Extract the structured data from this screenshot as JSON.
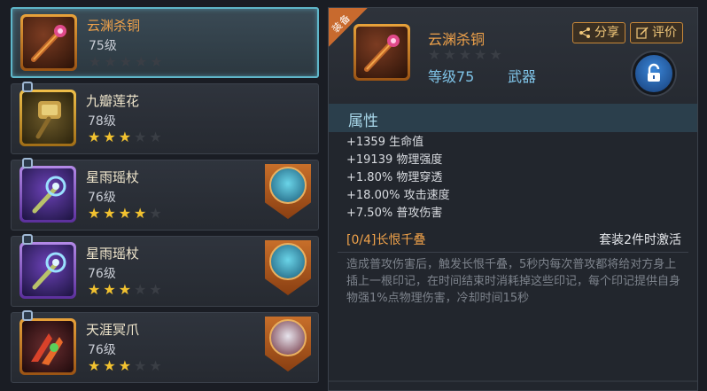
{
  "items": [
    {
      "name": "云渊杀铜",
      "level": "75级",
      "stars": 0,
      "selected": true,
      "locked": false,
      "badge": false
    },
    {
      "name": "九瓣莲花",
      "level": "78级",
      "stars": 3,
      "selected": false,
      "locked": true,
      "badge": false
    },
    {
      "name": "星雨瑶杖",
      "level": "76级",
      "stars": 4,
      "selected": false,
      "locked": true,
      "badge": true
    },
    {
      "name": "星雨瑶杖",
      "level": "76级",
      "stars": 3,
      "selected": false,
      "locked": true,
      "badge": true
    },
    {
      "name": "天涯冥爪",
      "level": "76级",
      "stars": 3,
      "selected": false,
      "locked": true,
      "badge": true
    }
  ],
  "detail": {
    "tag": "装备",
    "name": "云渊杀铜",
    "level": "等级75",
    "type": "武器",
    "share_label": "分享",
    "review_label": "评价"
  },
  "attributes": {
    "title": "属性",
    "stats": [
      "+1359 生命值",
      "+19139 物理强度",
      "+1.80% 物理穿透",
      "+18.00% 攻击速度",
      "+7.50% 普攻伤害"
    ]
  },
  "set_bonus": {
    "title": "[0/4]长恨千叠",
    "condition": "套装2件时激活",
    "description": "造成普攻伤害后，触发长恨千叠，5秒内每次普攻都将给对方身上插上一根印记，在时间结束时消耗掉这些印记，每个印记提供自身物强1%点物理伤害，冷却时间15秒"
  },
  "colors": {
    "accent": "#f0a24a",
    "info": "#7fc4e8",
    "star": "#f2c230",
    "selected_border": "#5fb6c9"
  }
}
